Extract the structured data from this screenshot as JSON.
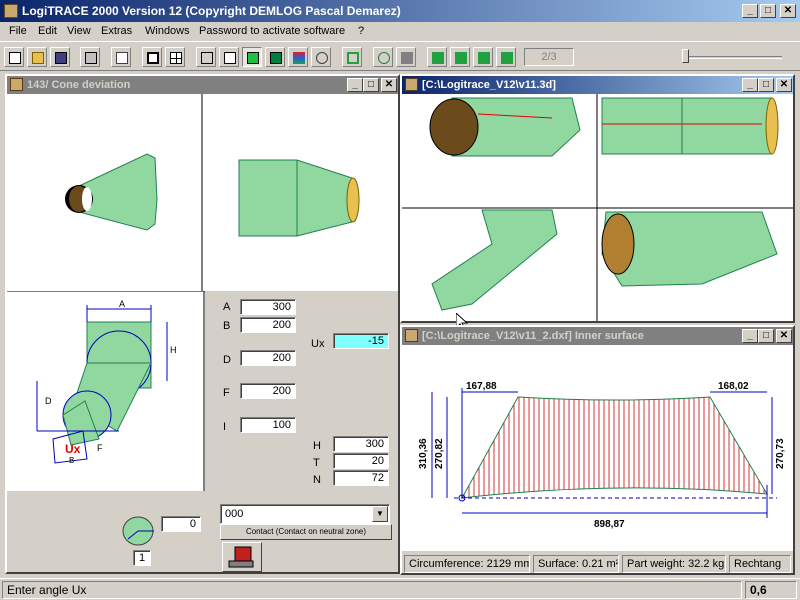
{
  "app": {
    "title": "LogiTRACE 2000  Version 12  (Copyright DEMLOG Pascal Demarez)"
  },
  "window_buttons": {
    "min": "_",
    "max": "□",
    "close": "✕"
  },
  "menu": [
    "File",
    "Edit",
    "View",
    "Extras",
    "Windows",
    "Password to activate software",
    "?"
  ],
  "toolbar": {
    "page_indicator": "2/3"
  },
  "left_window": {
    "title": "143/ Cone deviation",
    "params": {
      "A": {
        "label": "A",
        "value": "300"
      },
      "B": {
        "label": "B",
        "value": "200"
      },
      "D": {
        "label": "D",
        "value": "200"
      },
      "F": {
        "label": "F",
        "value": "200"
      },
      "I": {
        "label": "I",
        "value": "100"
      },
      "Ux": {
        "label": "Ux",
        "value": "-15"
      },
      "H": {
        "label": "H",
        "value": "300"
      },
      "T": {
        "label": "T",
        "value": "20"
      },
      "N": {
        "label": "N",
        "value": "72"
      }
    },
    "diagram_labels": {
      "A": "A",
      "H": "H",
      "D": "D",
      "F": "F",
      "Ux": "Ux",
      "B": "B"
    },
    "angle_value": "0",
    "angle_small": "1",
    "combo_value": "000",
    "contact_button": "Contact (Contact on neutral zone)"
  },
  "right_top_window": {
    "title": "[C:\\Logitrace_V12\\v11.3d]"
  },
  "right_bottom_window": {
    "title": "[C:\\Logitrace_V12\\v11_2.dxf]  Inner surface",
    "dims": {
      "top_left": "167,88",
      "top_right": "168,02",
      "left_outer": "310,36",
      "left_inner": "270,82",
      "right": "270,73",
      "bottom": "898,87"
    },
    "status": {
      "circumference": "Circumference: 2129 mm",
      "surface": "Surface: 0.21 m²",
      "weight": "Part weight: 32.2 kg",
      "shape": "Rechtang"
    }
  },
  "status_bar": {
    "message": "Enter angle Ux",
    "value": "0,6"
  },
  "colors": {
    "title_active": "#0a246a",
    "pipe_green": "#90d8a0",
    "dim_blue": "#0000c0",
    "hatch_red": "#cc0000",
    "ux_field": "#80ffff"
  }
}
